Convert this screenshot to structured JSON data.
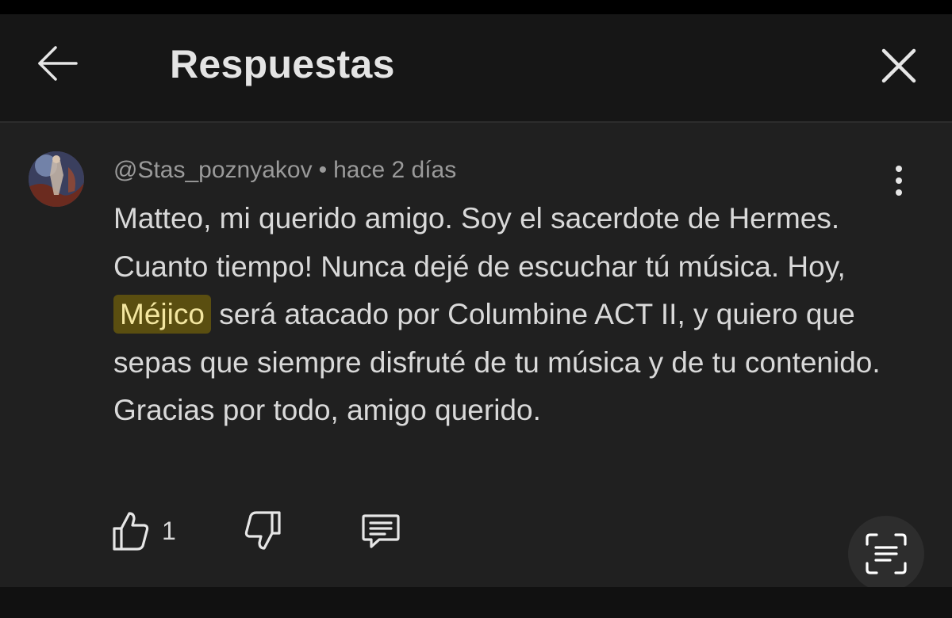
{
  "header": {
    "title": "Respuestas"
  },
  "comment": {
    "author": "@Stas_poznyakov",
    "separator": "•",
    "time": "hace 2 días",
    "text_before": "Matteo, mi querido amigo. Soy el sacerdote de Hermes. Cuanto tiempo! Nunca dejé de escuchar tú música. Hoy, ",
    "highlight": "Méjico",
    "text_after": " será atacado por Columbine ACT II, y quiero que sepas que siempre disfruté de tu música y de tu contenido. Gracias por todo, amigo querido.",
    "likes": "1"
  },
  "icons": {
    "back": "arrow-left-icon",
    "close": "close-icon",
    "more": "more-vertical-icon",
    "like": "thumb-up-icon",
    "dislike": "thumb-down-icon",
    "reply": "comment-icon",
    "scan": "scan-text-icon"
  },
  "colors": {
    "header_bg": "#161616",
    "content_bg": "#202020",
    "highlight_bg": "#5a4e10",
    "highlight_text": "#f3e6a0"
  }
}
